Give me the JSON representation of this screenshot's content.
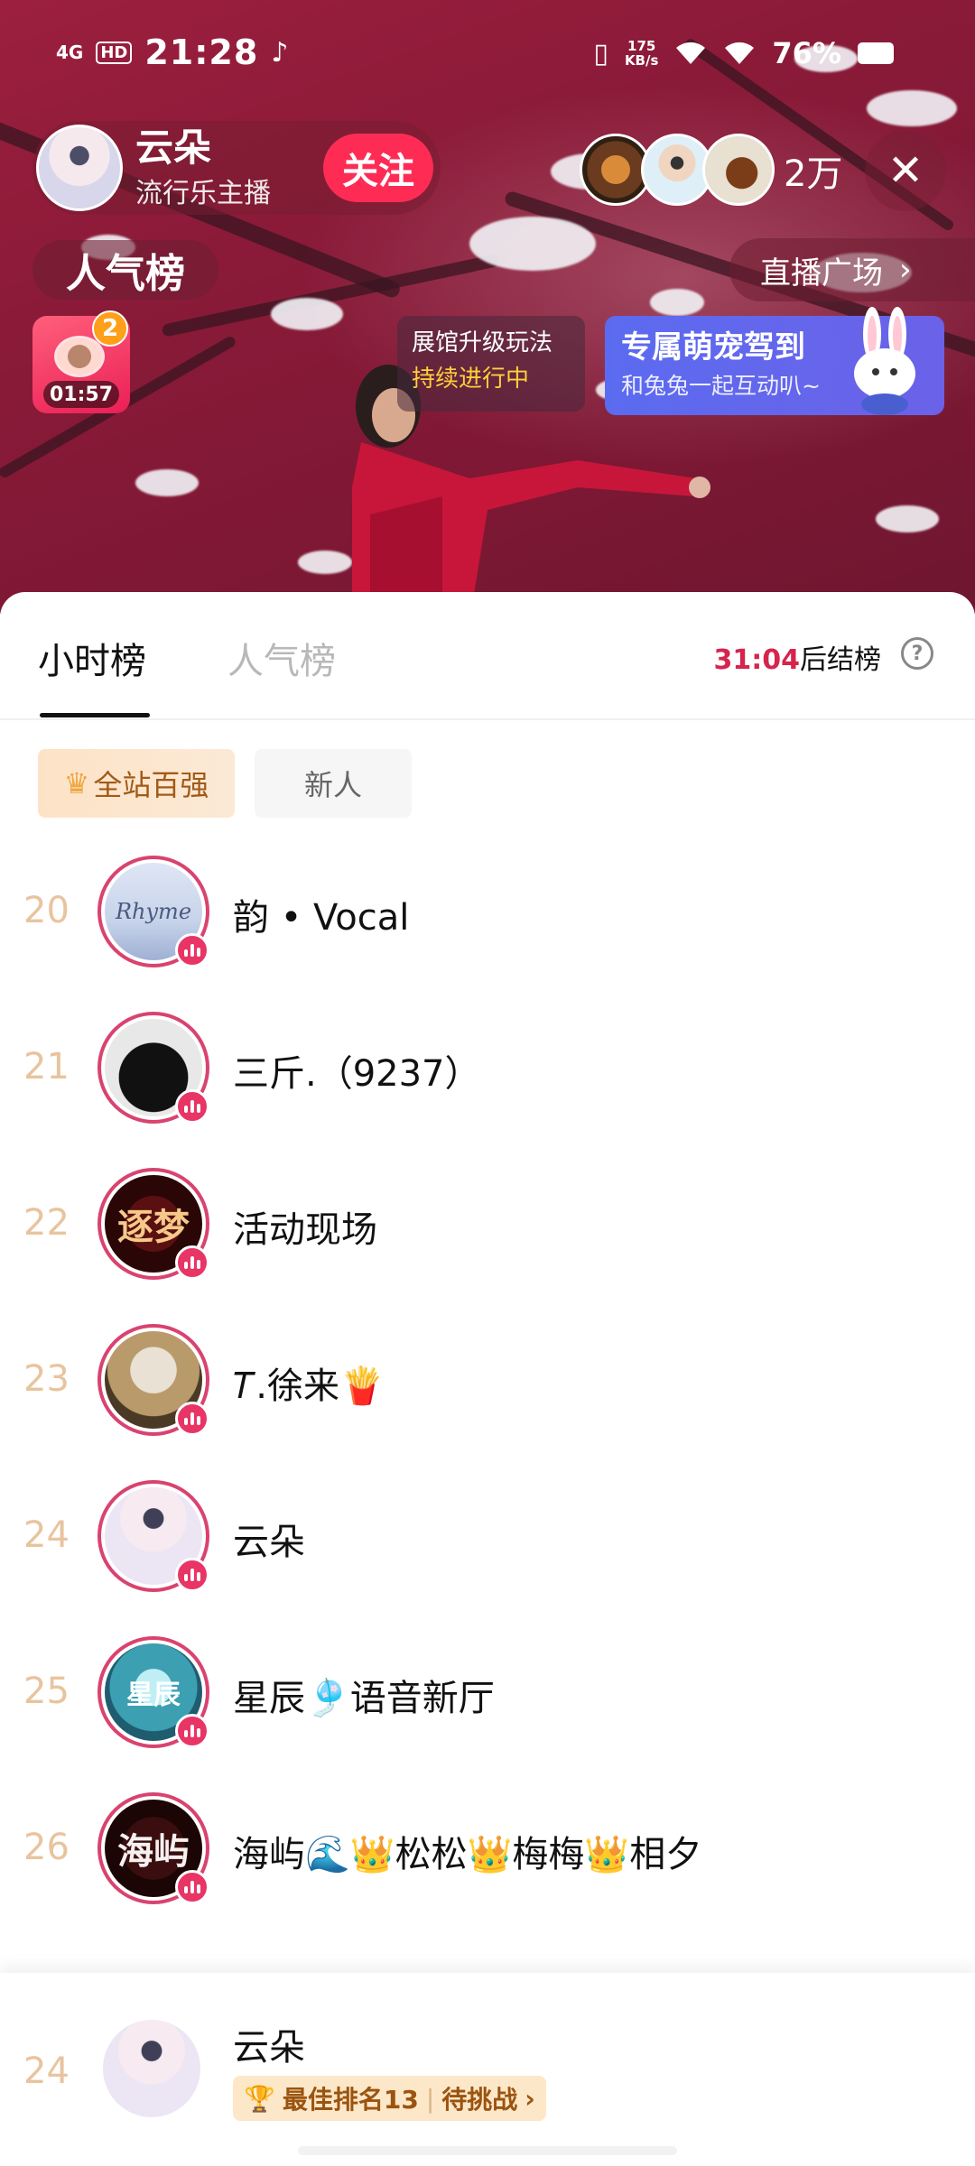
{
  "status_bar": {
    "network": "4G",
    "hd": "HD",
    "time": "21:28",
    "speed_value": "175",
    "speed_unit": "KB/s",
    "battery": "76%"
  },
  "streamer": {
    "name": "云朵",
    "subtitle": "流行乐主播",
    "follow_label": "关注"
  },
  "viewers": {
    "count": "2万",
    "close_icon": "close-icon"
  },
  "popularity_chip": "人气榜",
  "live_plaza": "直播广场",
  "gift": {
    "badge": "2",
    "timer": "01:57"
  },
  "promo_hall": {
    "line1": "展馆升级玩法",
    "line2": "持续进行中"
  },
  "promo_pet": {
    "line1": "专属萌宠驾到",
    "line2": "和兔兔一起互动叭~"
  },
  "ranking": {
    "tabs": [
      {
        "label": "小时榜",
        "active": true
      },
      {
        "label": "人气榜",
        "active": false
      }
    ],
    "countdown_time": "31:04",
    "countdown_suffix": "后结榜",
    "filters": [
      {
        "label": "全站百强",
        "active": true
      },
      {
        "label": "新人",
        "active": false
      }
    ],
    "items": [
      {
        "rank": "20",
        "name": "韵 • Vocal",
        "avatar_text": "Rhyme"
      },
      {
        "rank": "21",
        "name": "三斤.（9237）",
        "avatar_text": ""
      },
      {
        "rank": "22",
        "name": "活动现场",
        "avatar_text": "逐梦"
      },
      {
        "rank": "23",
        "name": "𝑇.徐来🍟",
        "avatar_text": ""
      },
      {
        "rank": "24",
        "name": "云朵",
        "avatar_text": ""
      },
      {
        "rank": "25",
        "name": "星辰🎐语音新厅",
        "avatar_text": "星辰"
      },
      {
        "rank": "26",
        "name": "海屿🌊👑松松👑梅梅👑相夕",
        "avatar_text": "海屿"
      }
    ]
  },
  "my_rank": {
    "rank": "24",
    "name": "云朵",
    "best_label": "最佳排名13",
    "challenge_label": "待挑战"
  },
  "colors": {
    "accent_red": "#fe2c55",
    "countdown_red": "#d6244c",
    "rank_gold": "#e8c49e"
  }
}
